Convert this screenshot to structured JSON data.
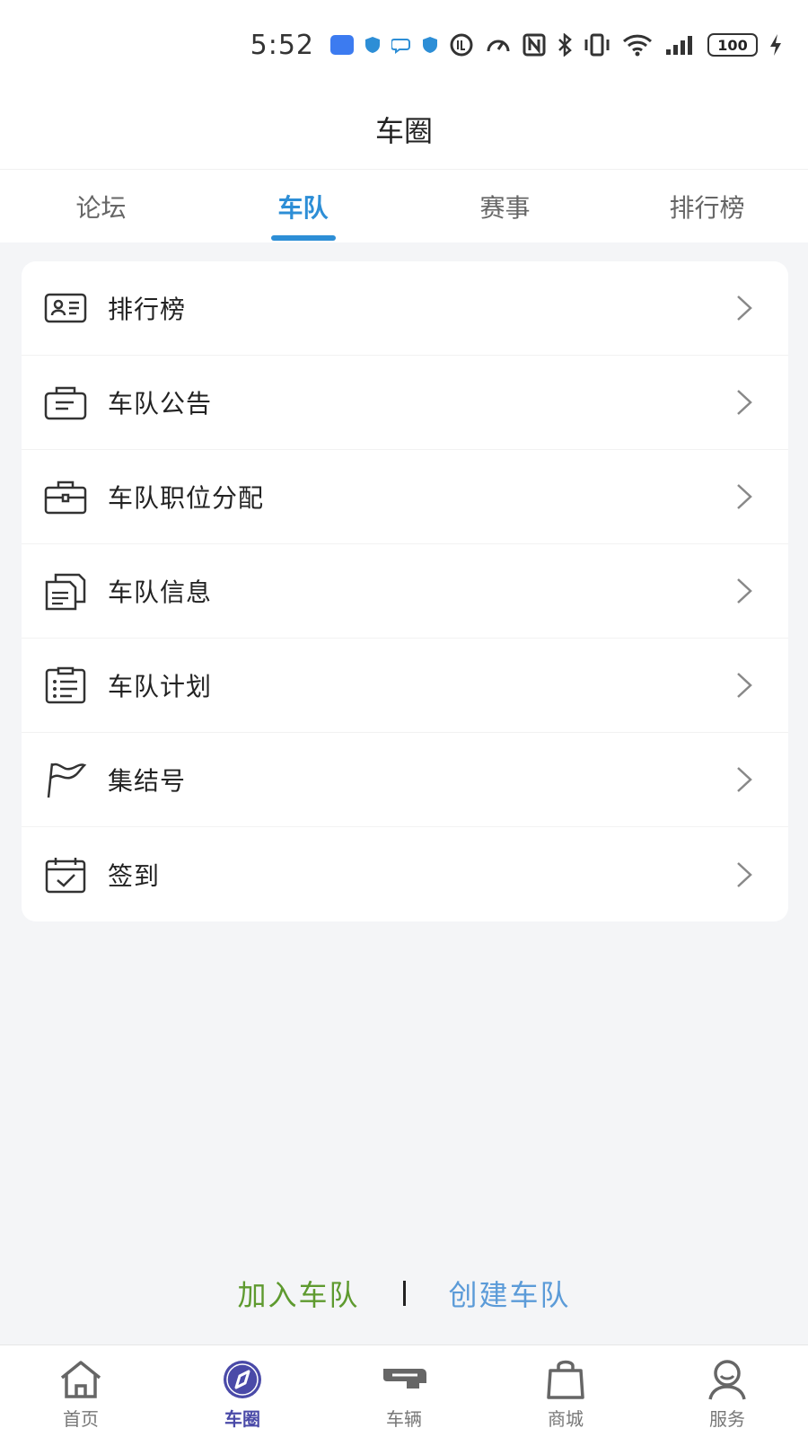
{
  "status_bar": {
    "time": "5:52",
    "battery": "100",
    "icons": [
      "usb-icon",
      "shield-icon",
      "chat-icon",
      "shield-icon",
      "data-saver-icon",
      "speed-icon",
      "nfc-icon",
      "bluetooth-icon",
      "vibrate-icon",
      "wifi-icon",
      "signal-icon",
      "battery-icon",
      "charging-icon"
    ]
  },
  "header": {
    "title": "车圈"
  },
  "tabs": [
    {
      "label": "论坛",
      "active": false
    },
    {
      "label": "车队",
      "active": true
    },
    {
      "label": "赛事",
      "active": false
    },
    {
      "label": "排行榜",
      "active": false
    }
  ],
  "menu": {
    "items": [
      {
        "label": "排行榜",
        "icon": "id-card-icon"
      },
      {
        "label": "车队公告",
        "icon": "notice-bag-icon"
      },
      {
        "label": "车队职位分配",
        "icon": "briefcase-icon"
      },
      {
        "label": "车队信息",
        "icon": "documents-icon"
      },
      {
        "label": "车队计划",
        "icon": "checklist-icon"
      },
      {
        "label": "集结号",
        "icon": "flag-icon"
      },
      {
        "label": "签到",
        "icon": "calendar-check-icon"
      }
    ]
  },
  "actions": {
    "join_label": "加入车队",
    "create_label": "创建车队",
    "separator": "|"
  },
  "bottom_nav": {
    "items": [
      {
        "label": "首页",
        "icon": "home-icon",
        "active": false
      },
      {
        "label": "车圈",
        "icon": "compass-icon",
        "active": true
      },
      {
        "label": "车辆",
        "icon": "car-icon",
        "active": false
      },
      {
        "label": "商城",
        "icon": "shopping-bag-icon",
        "active": false
      },
      {
        "label": "服务",
        "icon": "customer-service-icon",
        "active": false
      }
    ]
  },
  "colors": {
    "accent": "#2d8ed6",
    "join": "#5e9a2f",
    "create": "#5b9bd8",
    "nav_active": "#4a4aa8",
    "background": "#f4f5f7"
  }
}
